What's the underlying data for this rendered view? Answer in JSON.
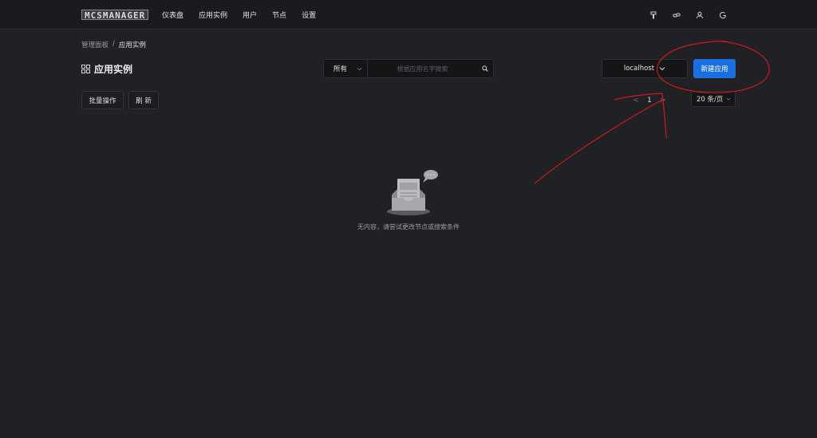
{
  "app": {
    "logo_text": "MCSMANAGER"
  },
  "nav": {
    "items": [
      {
        "label": "仪表盘"
      },
      {
        "label": "应用实例"
      },
      {
        "label": "用户"
      },
      {
        "label": "节点"
      },
      {
        "label": "设置"
      }
    ]
  },
  "top_icons": [
    "brush-icon",
    "link-icon",
    "user-icon",
    "logout-icon"
  ],
  "breadcrumb": {
    "parent": "管理面板",
    "separator": "/",
    "current": "应用实例"
  },
  "page": {
    "title": "应用实例"
  },
  "search": {
    "filter_value": "所有",
    "placeholder": "根据应用名字搜索"
  },
  "node_select": {
    "value": "localhost"
  },
  "buttons": {
    "new_app": "新建应用",
    "batch": "批量操作",
    "refresh": "刷 新"
  },
  "pagination": {
    "prev": "<",
    "current_page": "1",
    "next": ">",
    "page_size": "20 条/页"
  },
  "empty": {
    "message": "无内容，请尝试更改节点或搜索条件"
  },
  "colors": {
    "background": "#202125",
    "topbar": "#1a1b1e",
    "primary": "#1a6fe0",
    "annotation": "#d01818"
  }
}
